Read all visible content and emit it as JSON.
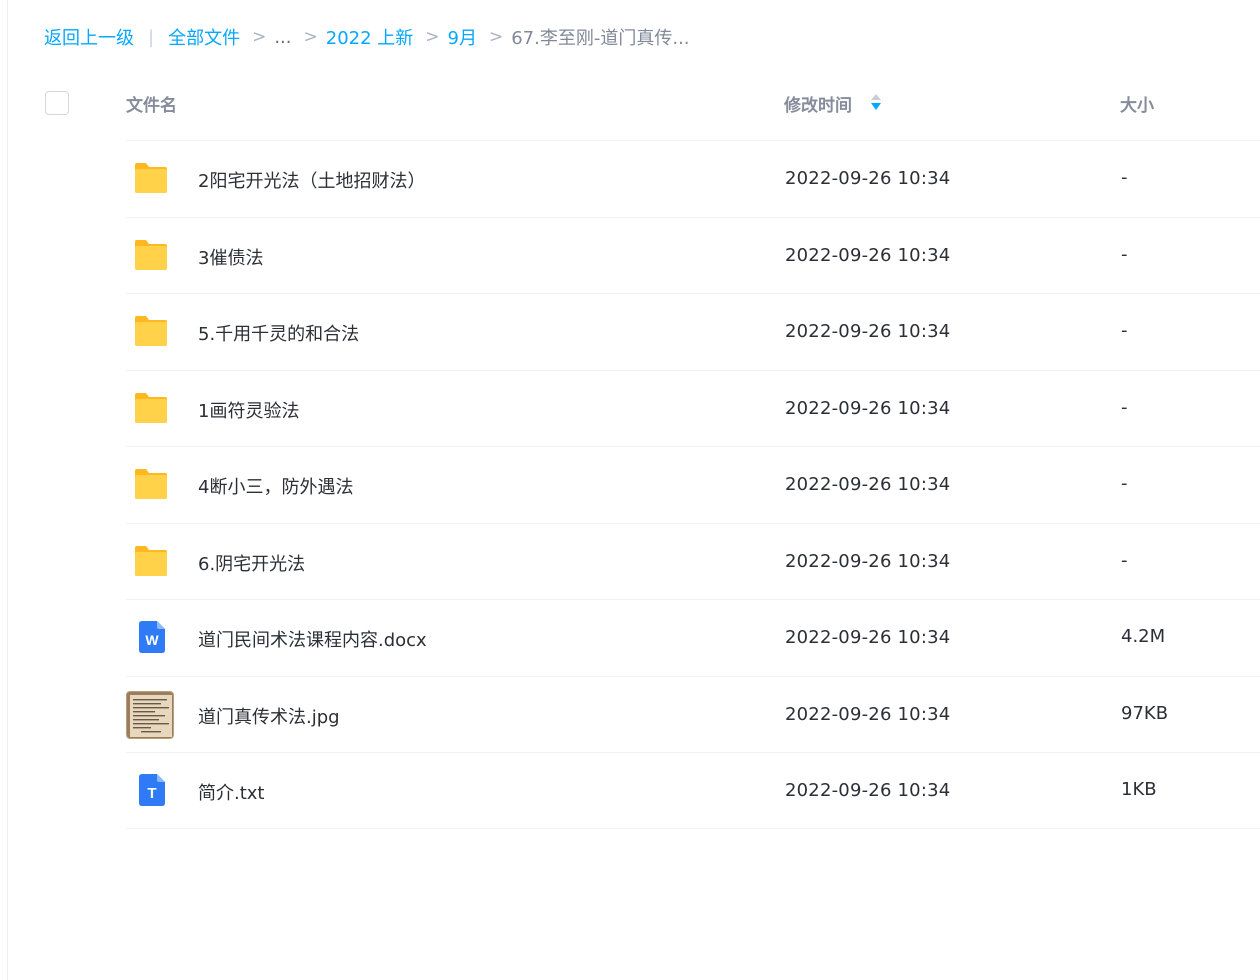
{
  "breadcrumb": {
    "back": "返回上一级",
    "all_files": "全部文件",
    "ellipsis": "...",
    "level1": "2022 上新",
    "level2": "9月",
    "current": "67.李至刚-道门真传...",
    "sep": ">",
    "bar": "|"
  },
  "header": {
    "name": "文件名",
    "time": "修改时间",
    "size": "大小"
  },
  "colors": {
    "link": "#06a7ff",
    "folder": "#ffc93a",
    "doc_blue": "#2f7bf5"
  },
  "files": [
    {
      "name": "2阳宅开光法（土地招财法）",
      "time": "2022-09-26 10:34",
      "size": "-",
      "icon": "folder-icon"
    },
    {
      "name": "3催债法",
      "time": "2022-09-26 10:34",
      "size": "-",
      "icon": "folder-icon"
    },
    {
      "name": "5.千用千灵的和合法",
      "time": "2022-09-26 10:34",
      "size": "-",
      "icon": "folder-icon"
    },
    {
      "name": "1画符灵验法",
      "time": "2022-09-26 10:34",
      "size": "-",
      "icon": "folder-icon"
    },
    {
      "name": "4断小三，防外遇法",
      "time": "2022-09-26 10:34",
      "size": "-",
      "icon": "folder-icon"
    },
    {
      "name": "6.阴宅开光法",
      "time": "2022-09-26 10:34",
      "size": "-",
      "icon": "folder-icon"
    },
    {
      "name": "道门民间术法课程内容.docx",
      "time": "2022-09-26 10:34",
      "size": "4.2M",
      "icon": "word-doc-icon",
      "glyph": "W"
    },
    {
      "name": "道门真传术法.jpg",
      "time": "2022-09-26 10:34",
      "size": "97KB",
      "icon": "image-thumbnail"
    },
    {
      "name": "简介.txt",
      "time": "2022-09-26 10:34",
      "size": "1KB",
      "icon": "text-file-icon",
      "glyph": "T"
    }
  ]
}
